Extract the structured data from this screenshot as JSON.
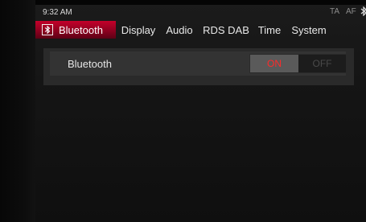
{
  "status": {
    "time": "9:32 AM",
    "ta": "TA",
    "af": "AF",
    "bluetooth_icon": "bluetooth-icon"
  },
  "tabs": [
    {
      "label": "Bluetooth",
      "active": true,
      "icon": "bluetooth-icon"
    },
    {
      "label": "Display"
    },
    {
      "label": "Audio"
    },
    {
      "label": "RDS DAB"
    },
    {
      "label": "Time"
    },
    {
      "label": "System"
    }
  ],
  "settings": {
    "bluetooth_row": {
      "label": "Bluetooth",
      "on_label": "ON",
      "off_label": "OFF",
      "selected": "ON"
    }
  },
  "colors": {
    "active_tab": "#c4002a",
    "on_text": "#ff2a2a",
    "off_text": "#4a4a4a"
  }
}
